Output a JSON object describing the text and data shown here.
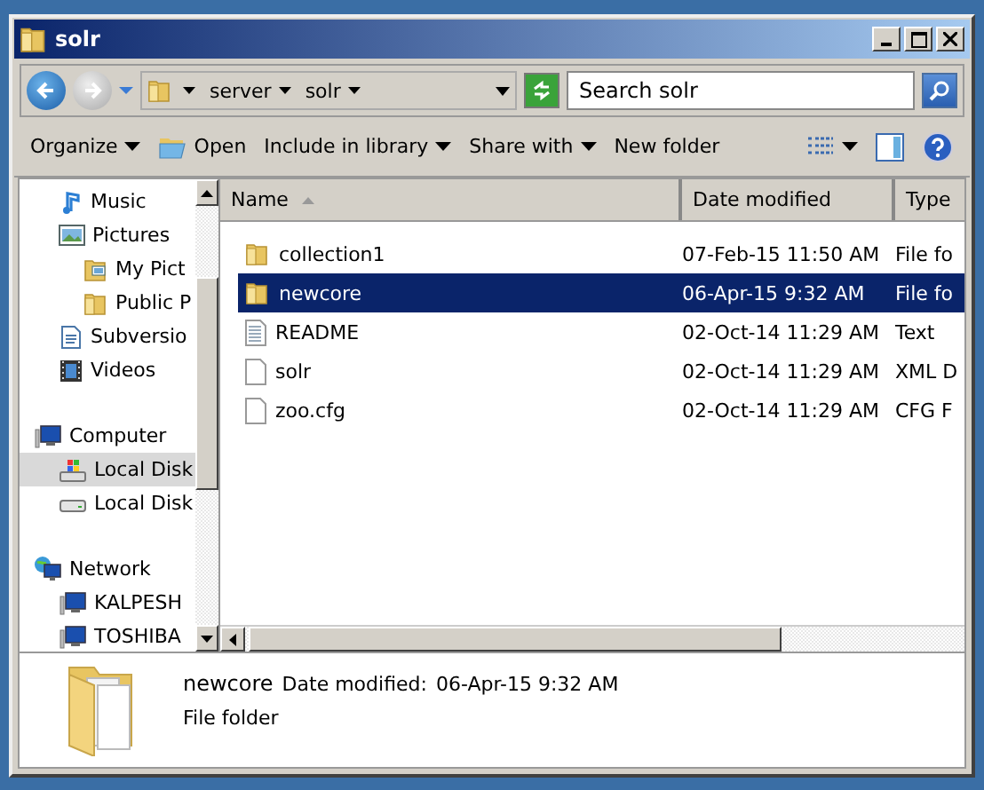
{
  "window": {
    "title": "solr"
  },
  "address": {
    "path": [
      "server",
      "solr"
    ]
  },
  "search": {
    "placeholder": "Search solr"
  },
  "toolbar": [
    {
      "label": "Organize",
      "kind": "menu"
    },
    {
      "label": "Open",
      "kind": "open"
    },
    {
      "label": "Include in library",
      "kind": "menu"
    },
    {
      "label": "Share with",
      "kind": "menu"
    },
    {
      "label": "New folder",
      "kind": "plain"
    }
  ],
  "nav": {
    "sections": [
      {
        "items": [
          {
            "label": "Music",
            "kind": "music",
            "selected": false
          },
          {
            "label": "Pictures",
            "kind": "pictures",
            "selected": false,
            "children": [
              {
                "label": "My Pict",
                "kind": "picture-folder",
                "selected": false
              },
              {
                "label": "Public P",
                "kind": "folder",
                "selected": false
              }
            ]
          },
          {
            "label": "Subversio",
            "kind": "document",
            "selected": false
          },
          {
            "label": "Videos",
            "kind": "video",
            "selected": false
          }
        ]
      },
      {
        "header": {
          "label": "Computer",
          "kind": "computer",
          "selected": false
        },
        "items": [
          {
            "label": "Local Disk",
            "kind": "system-drive",
            "selected": true
          },
          {
            "label": "Local Disk",
            "kind": "drive",
            "selected": false
          }
        ]
      },
      {
        "header": {
          "label": "Network",
          "kind": "network",
          "selected": false
        },
        "items": [
          {
            "label": "KALPESH",
            "kind": "computer",
            "selected": false
          },
          {
            "label": "TOSHIBA",
            "kind": "computer",
            "selected": false
          }
        ]
      }
    ]
  },
  "columns": [
    "Name",
    "Date modified",
    "Type"
  ],
  "rows": [
    {
      "name": "collection1",
      "date": "07-Feb-15 11:50 AM",
      "type": "File fo",
      "kind": "folder",
      "selected": false
    },
    {
      "name": "newcore",
      "date": "06-Apr-15 9:32 AM",
      "type": "File fo",
      "kind": "folder",
      "selected": true
    },
    {
      "name": "README",
      "date": "02-Oct-14 11:29 AM",
      "type": "Text",
      "kind": "text",
      "selected": false
    },
    {
      "name": "solr",
      "date": "02-Oct-14 11:29 AM",
      "type": "XML D",
      "kind": "file",
      "selected": false
    },
    {
      "name": "zoo.cfg",
      "date": "02-Oct-14 11:29 AM",
      "type": "CFG F",
      "kind": "file",
      "selected": false
    }
  ],
  "details": {
    "name": "newcore",
    "date_label": "Date modified:",
    "date": "06-Apr-15 9:32 AM",
    "type": "File folder"
  }
}
